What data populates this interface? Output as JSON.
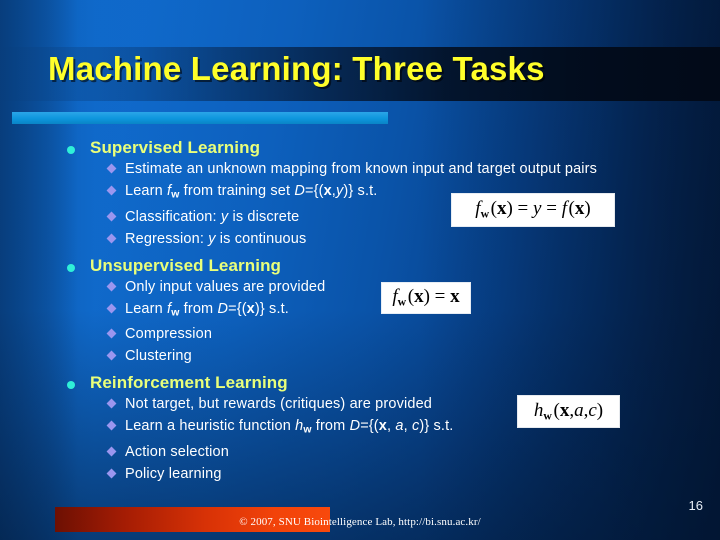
{
  "slide": {
    "title": "Machine Learning: Three Tasks",
    "page_number": "16",
    "footer": "© 2007, SNU Biointelligence Lab, http://bi.snu.ac.kr/",
    "colors": {
      "title_text": "#ffff2a",
      "heading_text": "#e9ff7a",
      "body_text": "#ffffff",
      "level1_bullet": "#2ff0d8",
      "level2_bullet": "#9b96ef",
      "accent_bar": "#0d96dd",
      "footer_bar": "#f2430a",
      "background_light": "#0e67c9",
      "background_dark": "#031c3f"
    }
  },
  "sections": [
    {
      "heading": "Supervised Learning",
      "bullets": [
        {
          "id": "sup-1",
          "text": "Estimate an unknown mapping from known input and target output pairs"
        },
        {
          "id": "sup-2",
          "text": "Learn fw from training set D={(x,y)} s.t."
        },
        {
          "id": "sup-3",
          "text": "Classification: y is discrete"
        },
        {
          "id": "sup-4",
          "text": "Regression: y is continuous"
        }
      ]
    },
    {
      "heading": "Unsupervised Learning",
      "bullets": [
        {
          "id": "uns-1",
          "text": "Only input values are provided"
        },
        {
          "id": "uns-2",
          "text": "Learn fw from D={(x)} s.t."
        },
        {
          "id": "uns-3",
          "text": "Compression"
        },
        {
          "id": "uns-4",
          "text": "Clustering"
        }
      ]
    },
    {
      "heading": "Reinforcement Learning",
      "bullets": [
        {
          "id": "rei-1",
          "text": "Not target, but rewards (critiques) are provided"
        },
        {
          "id": "rei-2",
          "text": "Learn a heuristic function hw from D={(x, a, c)} s.t."
        },
        {
          "id": "rei-3",
          "text": "Action selection"
        },
        {
          "id": "rei-4",
          "text": "Policy learning"
        }
      ]
    }
  ],
  "equations": [
    {
      "id": "eq1",
      "text": "fw(x) = y = f(x)"
    },
    {
      "id": "eq2",
      "text": "fw(x) = x"
    },
    {
      "id": "eq3",
      "text": "hw(x, a, c)"
    }
  ]
}
